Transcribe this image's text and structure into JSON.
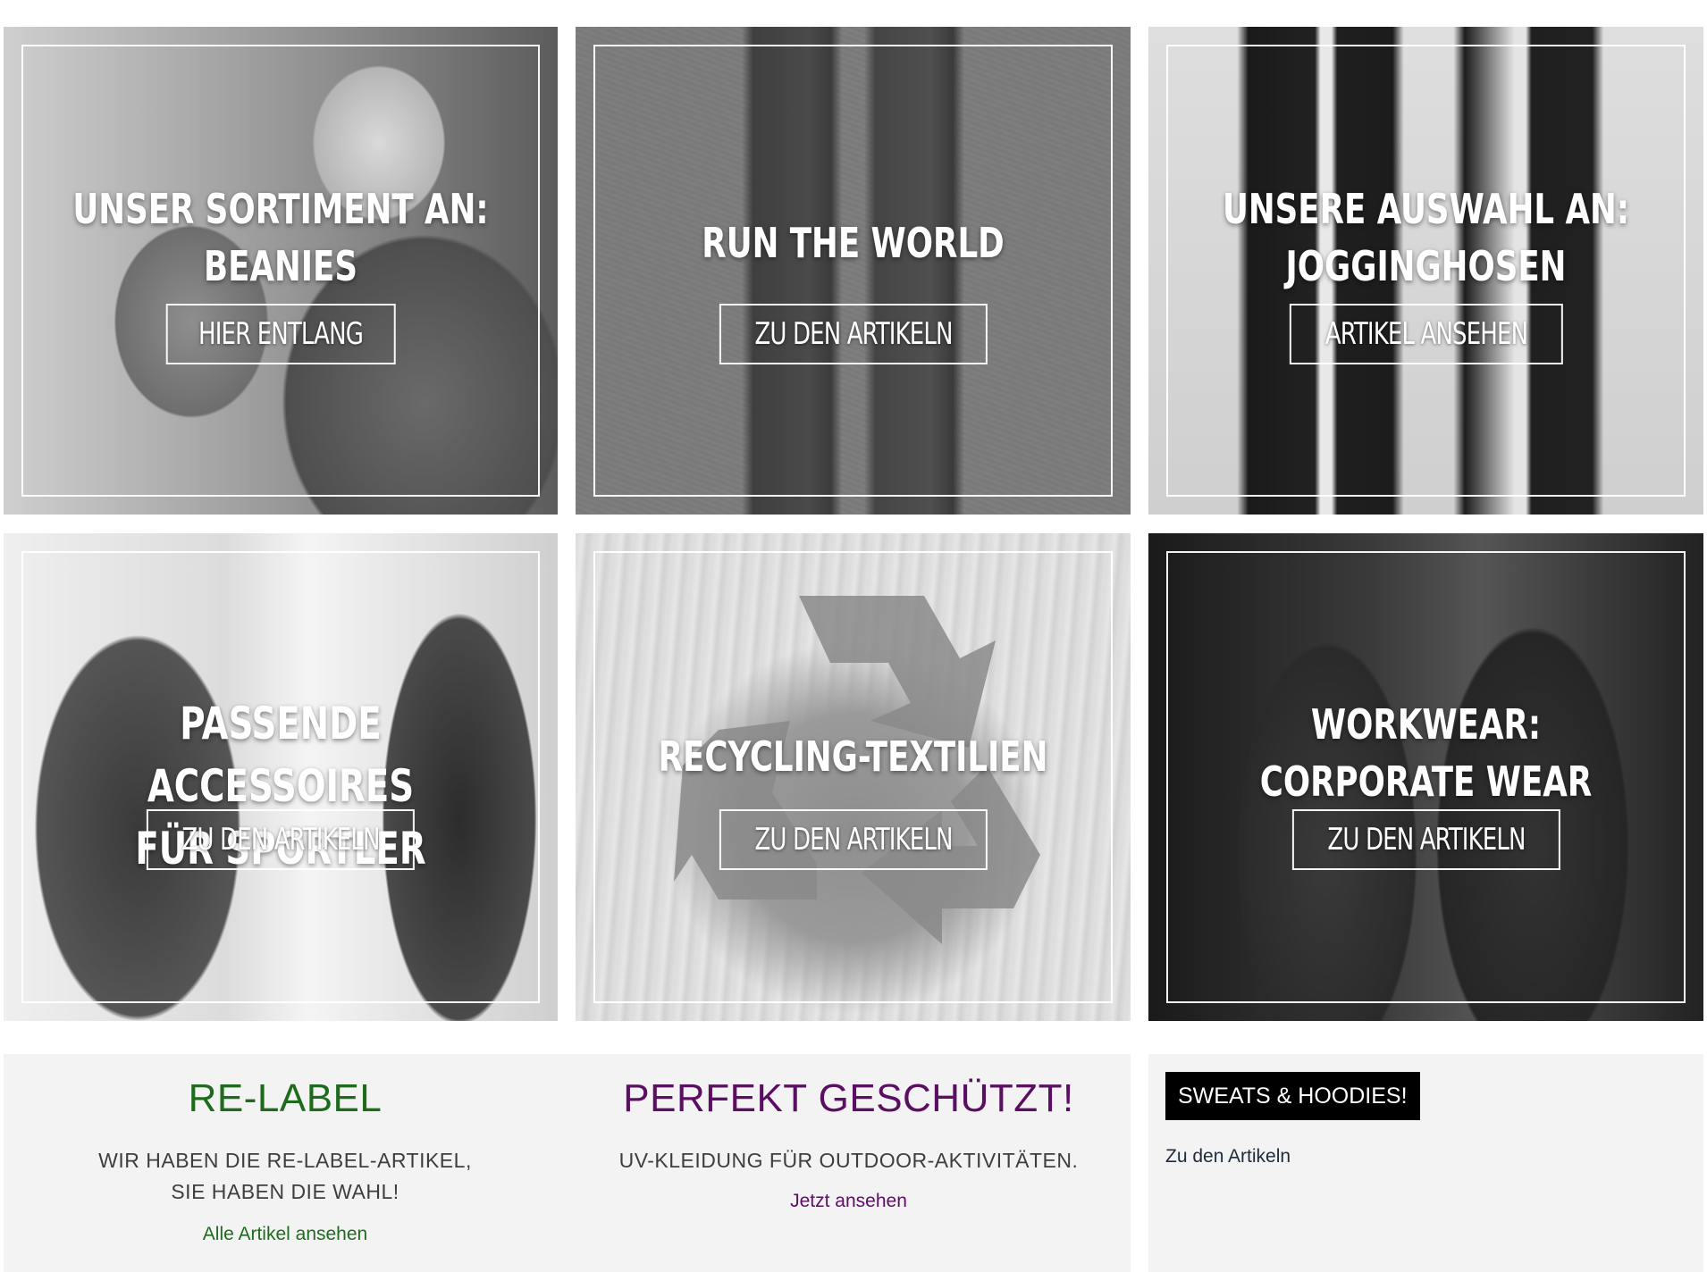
{
  "tiles": [
    {
      "headline_line1": "UNSER SORTIMENT AN:",
      "headline_line2": "BEANIES",
      "button": "HIER ENTLANG"
    },
    {
      "headline_line1": "RUN THE WORLD",
      "headline_line2": "",
      "button": "ZU DEN ARTIKELN"
    },
    {
      "headline_line1": "UNSERE AUSWAHL AN:",
      "headline_line2": "JOGGINGHOSEN",
      "button": "ARTIKEL ANSEHEN"
    },
    {
      "headline_line1": "PASSENDE ACCESSOIRES",
      "headline_line2": "FÜR SPORTLER",
      "button": "ZU DEN ARTIKELN"
    },
    {
      "headline_line1": "RECYCLING-TEXTILIEN",
      "headline_line2": "",
      "button": "ZU DEN ARTIKELN"
    },
    {
      "headline_line1": "WORKWEAR:",
      "headline_line2": "CORPORATE WEAR",
      "button": "ZU DEN ARTIKELN"
    }
  ],
  "promos": {
    "relabel": {
      "title": "RE-LABEL",
      "text_line1": "WIR HABEN DIE RE-LABEL-ARTIKEL,",
      "text_line2": "SIE HABEN DIE WAHL!",
      "link": "Alle Artikel ansehen",
      "color": "#1e6b1e"
    },
    "uv": {
      "title": "PERFEKT GESCHÜTZT!",
      "text": "UV-KLEIDUNG FÜR OUTDOOR-AKTIVITÄTEN.",
      "link": "Jetzt ansehen",
      "color": "#5b0f62"
    },
    "sweats": {
      "badge": "SWEATS & HOODIES!",
      "link": "Zu den Artikeln"
    }
  }
}
